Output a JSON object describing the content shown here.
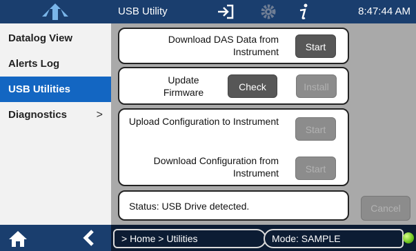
{
  "header": {
    "title": "USB Utility",
    "time": "8:47:44 AM",
    "icons": [
      "logo-icon",
      "login-icon",
      "gear-icon",
      "info-icon"
    ]
  },
  "sidebar": {
    "items": [
      {
        "label": "Datalog View",
        "active": false
      },
      {
        "label": "Alerts Log",
        "active": false
      },
      {
        "label": "USB Utilities",
        "active": true
      },
      {
        "label": "Diagnostics",
        "active": false,
        "chevron": ">"
      }
    ]
  },
  "main": {
    "download_das": {
      "label": "Download DAS Data from Instrument",
      "button": "Start"
    },
    "firmware": {
      "label": "Update Firmware",
      "check_button": "Check",
      "install_button": "Install"
    },
    "upload_config": {
      "label": "Upload Configuration to Instrument",
      "button": "Start"
    },
    "download_config": {
      "label": "Download Configuration from Instrument",
      "button": "Start"
    },
    "status": {
      "text": "Status: USB Drive detected."
    },
    "cancel_button": "Cancel"
  },
  "footer": {
    "breadcrumb": "> Home > Utilities",
    "mode": "Mode: SAMPLE",
    "status_color": "#6cc41c"
  },
  "colors": {
    "header_bg": "#1a3e6e",
    "active_nav": "#1366c2",
    "panel_bg": "#a9a9a9"
  }
}
